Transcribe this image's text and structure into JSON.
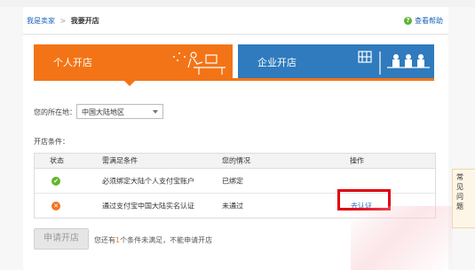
{
  "breadcrumb": {
    "home": "我是卖家",
    "separator": ">",
    "current": "我要开店"
  },
  "help": {
    "icon": "help-icon",
    "label": "查看帮助"
  },
  "tabs": [
    {
      "label": "个人开店",
      "active": true,
      "icon": "person-desk-illustration",
      "color": "#f37416"
    },
    {
      "label": "企业开店",
      "active": false,
      "icon": "meeting-illustration",
      "color": "#2f7bbd"
    }
  ],
  "location": {
    "label": "您的所在地：",
    "value": "中国大陆地区"
  },
  "conditions": {
    "title": "开店条件：",
    "headers": [
      "状态",
      "需满足条件",
      "您的情况",
      "操作"
    ],
    "rows": [
      {
        "status": "ok",
        "status_icon": "✔",
        "condition": "必须绑定大陆个人支付宝账户",
        "situation": "已绑定",
        "action": ""
      },
      {
        "status": "fail",
        "status_icon": "✕",
        "condition": "通过支付宝中国大陆实名认证",
        "situation": "未通过",
        "action": "去认证"
      }
    ]
  },
  "apply_button": "申请开店",
  "footer_note": {
    "prefix": "您还有",
    "count": "1",
    "suffix": "个条件未满足，不能申请开店"
  },
  "side_panel": [
    "常",
    "见",
    "问",
    "题"
  ],
  "colors": {
    "accent_orange": "#f37416",
    "accent_blue": "#2f7bbd",
    "link": "#1a64b8",
    "highlight": "#e0000f"
  }
}
